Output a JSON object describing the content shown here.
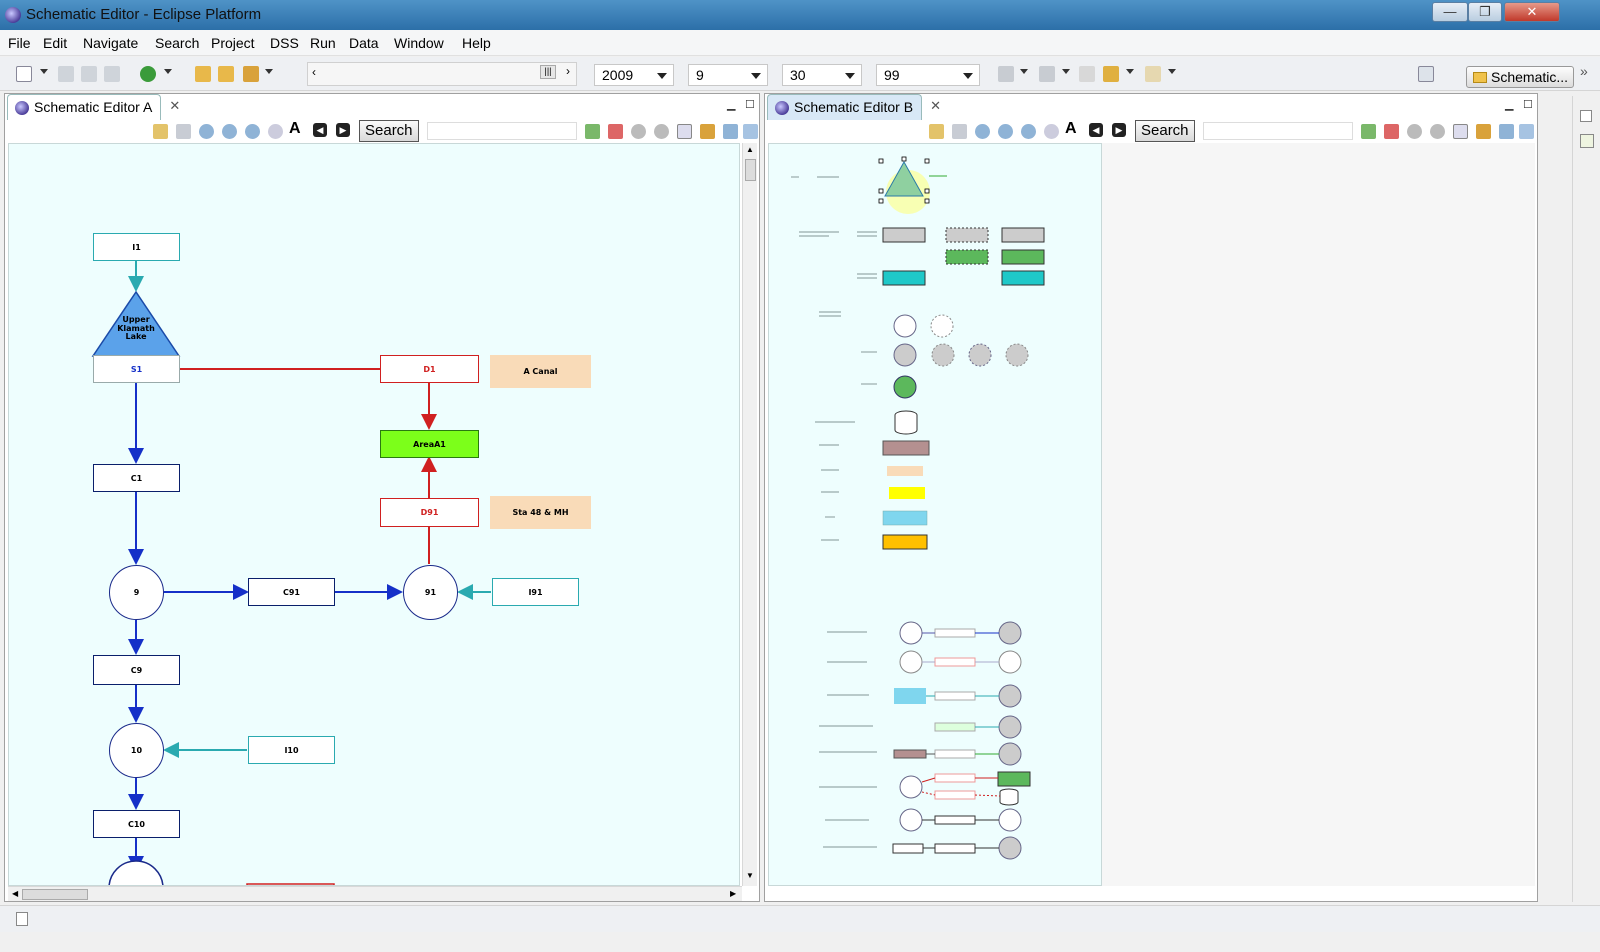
{
  "window": {
    "title": "Schematic Editor - Eclipse Platform"
  },
  "menubar": {
    "items": [
      "File",
      "Edit",
      "Navigate",
      "Search",
      "Project",
      "DSS",
      "Run",
      "Data",
      "Window",
      "Help"
    ]
  },
  "toolbar": {
    "year": "2009",
    "month": "9",
    "day": "30",
    "value": "99",
    "perspective_label": "Schematic..."
  },
  "editor_a": {
    "tab_label": "Schematic Editor A",
    "search_label": "Search",
    "search_value": "",
    "nodes": {
      "i1": "I1",
      "lake": "Upper Klamath Lake",
      "s1": "S1",
      "d1": "D1",
      "a_canal": "A Canal",
      "area_a1": "AreaA1",
      "c1": "C1",
      "d91": "D91",
      "sta48": "Sta 48 & MH",
      "n9": "9",
      "c91": "C91",
      "n91": "91",
      "i91": "I91",
      "c9": "C9",
      "n10": "10",
      "i10": "I10",
      "c10": "C10"
    }
  },
  "editor_b": {
    "tab_label": "Schematic Editor B",
    "search_label": "Search",
    "search_value": ""
  },
  "colors": {
    "inflow": "#2aaab0",
    "flow": "#1530c8",
    "diversion": "#d02020",
    "canvas": "#eefefe",
    "titlebar": "#3a7fb8"
  }
}
